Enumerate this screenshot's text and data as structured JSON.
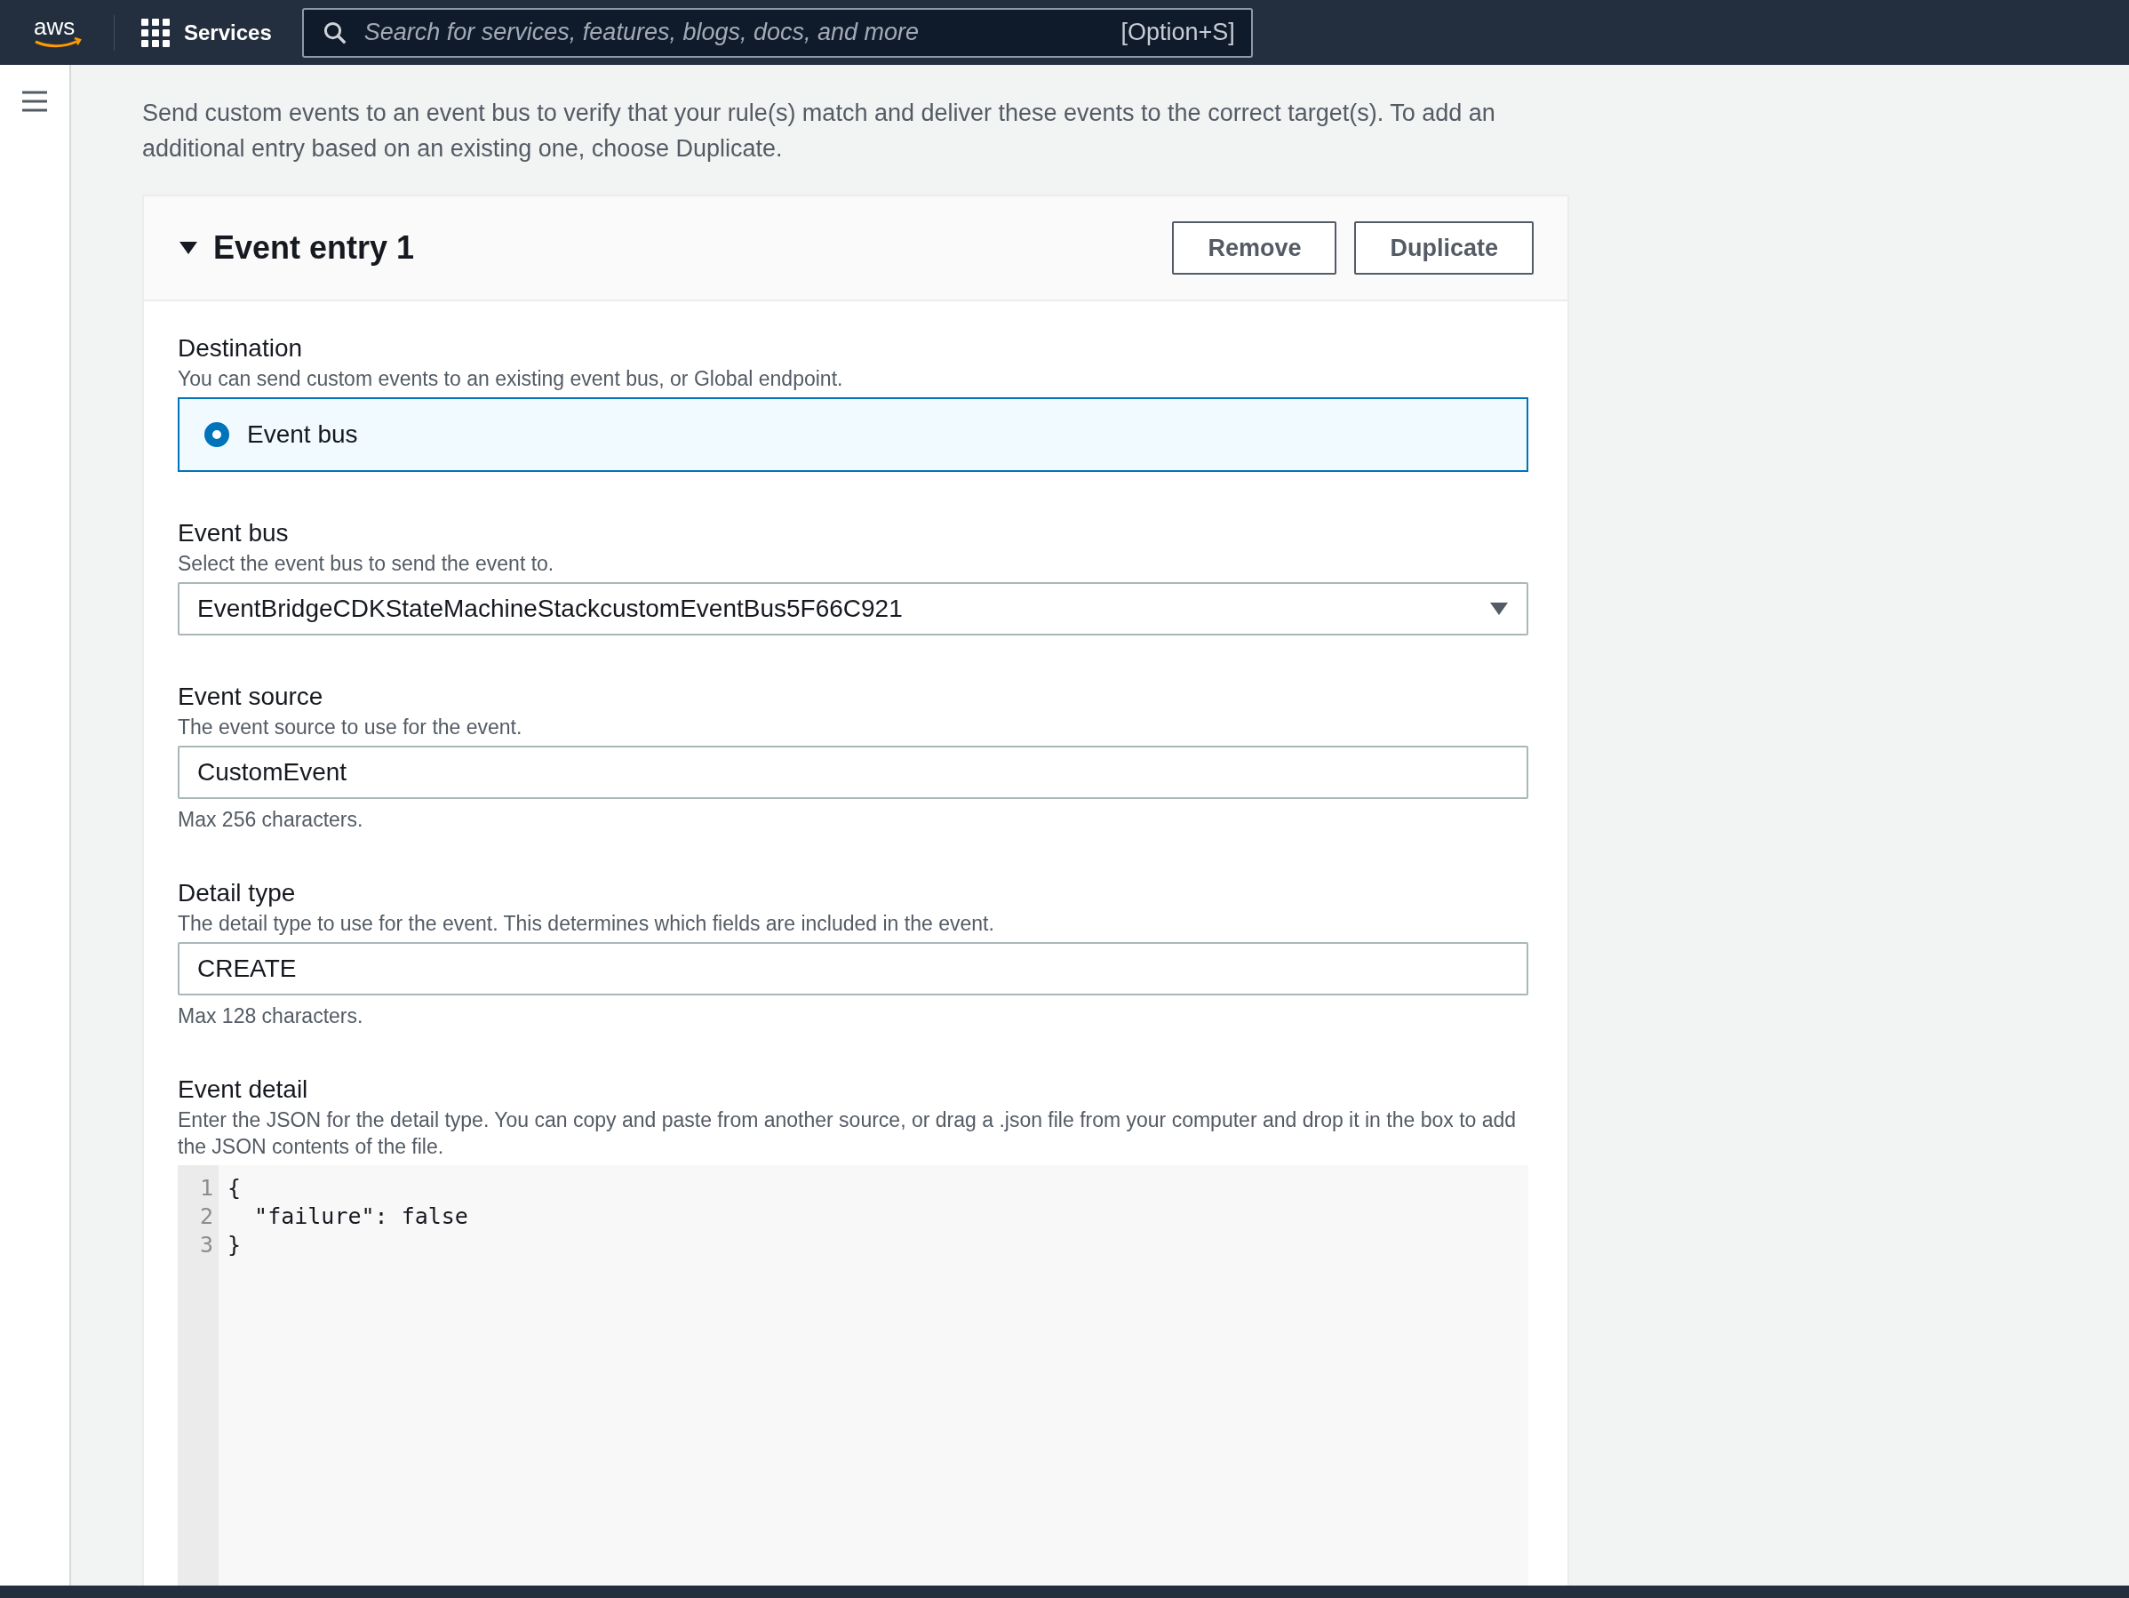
{
  "top_nav": {
    "logo_text": "aws",
    "services_label": "Services",
    "search": {
      "placeholder": "Search for services, features, blogs, docs, and more"
    },
    "shortcut": "[Option+S]"
  },
  "intro": "Send custom events to an event bus to verify that your rule(s) match and deliver these events to the correct target(s). To add an additional entry based on an existing one, choose Duplicate.",
  "entry": {
    "title": "Event entry 1",
    "expanded": true,
    "buttons": [
      "Remove",
      "Duplicate"
    ],
    "fields": [
      {
        "kind": "radio",
        "label": "Destination",
        "description": "You can send custom events to an existing event bus, or Global endpoint.",
        "options": [
          {
            "label": "Event bus",
            "selected": true
          }
        ]
      },
      {
        "kind": "select",
        "label": "Event bus",
        "description": "Select the event bus to send the event to.",
        "value": "EventBridgeCDKStateMachineStackcustomEventBus5F66C921"
      },
      {
        "kind": "input",
        "label": "Event source",
        "description": "The event source to use for the event.",
        "value": "CustomEvent",
        "hint": "Max 256 characters."
      },
      {
        "kind": "input",
        "label": "Detail type",
        "description": "The detail type to use for the event. This determines which fields are included in the event.",
        "value": "CREATE",
        "hint": "Max 128 characters."
      },
      {
        "kind": "code",
        "label": "Event detail",
        "description": "Enter the JSON for the detail type. You can copy and paste from another source, or drag a .json file from your computer and drop it in the box to add the JSON contents of the file.",
        "lines": [
          {
            "number": "1",
            "text": "{"
          },
          {
            "number": "2",
            "text": "  \"failure\": false"
          },
          {
            "number": "3",
            "text": "}"
          }
        ]
      }
    ]
  }
}
